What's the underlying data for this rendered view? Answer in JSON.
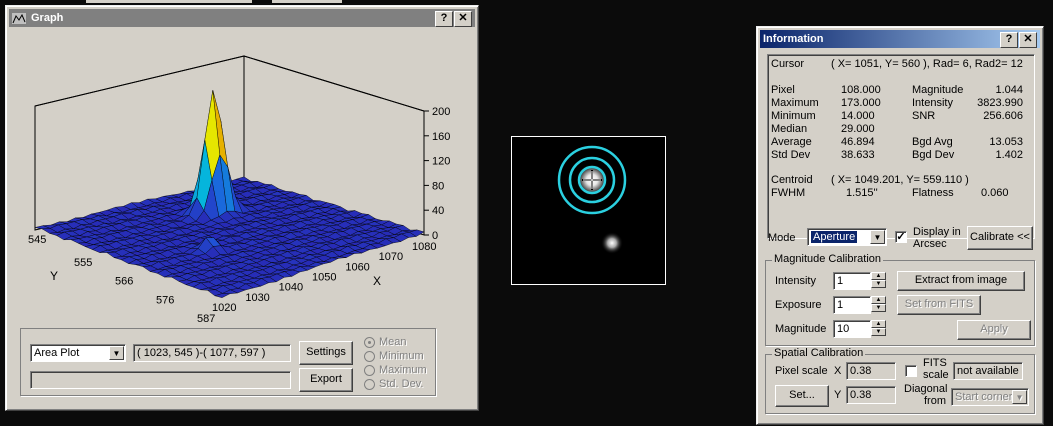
{
  "graph_window": {
    "title": "Graph",
    "help_btn": "?",
    "close_btn": "✕",
    "plot": {
      "z_ticks": [
        "200",
        "160",
        "120",
        "80",
        "40",
        "0"
      ],
      "y_ticks": [
        "545",
        "555",
        "566",
        "576",
        "587"
      ],
      "x_ticks": [
        "1020",
        "1030",
        "1040",
        "1050",
        "1060",
        "1070",
        "1080"
      ],
      "y_label": "Y",
      "x_label": "X"
    },
    "plot_type": "Area Plot",
    "range_text": "( 1023, 545 )-( 1077, 597 )",
    "settings_btn": "Settings",
    "export_btn": "Export",
    "radio_options": [
      "Mean",
      "Minimum",
      "Maximum",
      "Std. Dev."
    ]
  },
  "info_window": {
    "title": "Information",
    "help_btn": "?",
    "close_btn": "✕",
    "cursor_label": "Cursor",
    "cursor_value": "( X= 1051, Y=  560 ), Rad=  6, Rad2= 12",
    "left_stats": [
      {
        "label": "Pixel",
        "value": "108.000"
      },
      {
        "label": "Maximum",
        "value": "173.000"
      },
      {
        "label": "Minimum",
        "value": "14.000"
      },
      {
        "label": "Median",
        "value": "29.000"
      },
      {
        "label": "Average",
        "value": "46.894"
      },
      {
        "label": "Std Dev",
        "value": "38.633"
      }
    ],
    "right_stats": [
      {
        "label": "Magnitude",
        "value": "1.044"
      },
      {
        "label": "Intensity",
        "value": "3823.990"
      },
      {
        "label": "SNR",
        "value": "256.606"
      },
      {
        "label": "",
        "value": ""
      },
      {
        "label": "Bgd Avg",
        "value": "13.053"
      },
      {
        "label": "Bgd Dev",
        "value": "1.402"
      }
    ],
    "centroid_label": "Centroid",
    "centroid_value": "( X= 1049.201, Y=  559.110 )",
    "fwhm_label": "FWHM",
    "fwhm_value": "1.515''",
    "flatness_label": "Flatness",
    "flatness_value": "0.060",
    "mode_label": "Mode",
    "mode_value": "Aperture",
    "display_arcsec_line1": "Display in",
    "display_arcsec_line2": "Arcsec",
    "calibrate_btn": "Calibrate <<",
    "mag_cal": {
      "legend": "Magnitude Calibration",
      "intensity_label": "Intensity",
      "intensity_value": "1",
      "exposure_label": "Exposure",
      "exposure_value": "1",
      "magnitude_label": "Magnitude",
      "magnitude_value": "10",
      "extract_btn": "Extract from image",
      "setfits_btn": "Set from FITS",
      "apply_btn": "Apply"
    },
    "spatial_cal": {
      "legend": "Spatial Calibration",
      "pixel_scale_label": "Pixel scale",
      "x_label": "X",
      "x_value": "0.38",
      "y_label": "Y",
      "y_value": "0.38",
      "set_btn": "Set...",
      "fits_label_line1": "FITS",
      "fits_label_line2": "scale",
      "not_available": "not available",
      "diagonal_line1": "Diagonal",
      "diagonal_line2": "from",
      "start_corner": "Start corner"
    }
  },
  "colors": {
    "surface": "#2a2ab0",
    "aperture_ring": "#2bd0e0",
    "title_inactive": "#808080",
    "title_active": "#0a246a"
  }
}
